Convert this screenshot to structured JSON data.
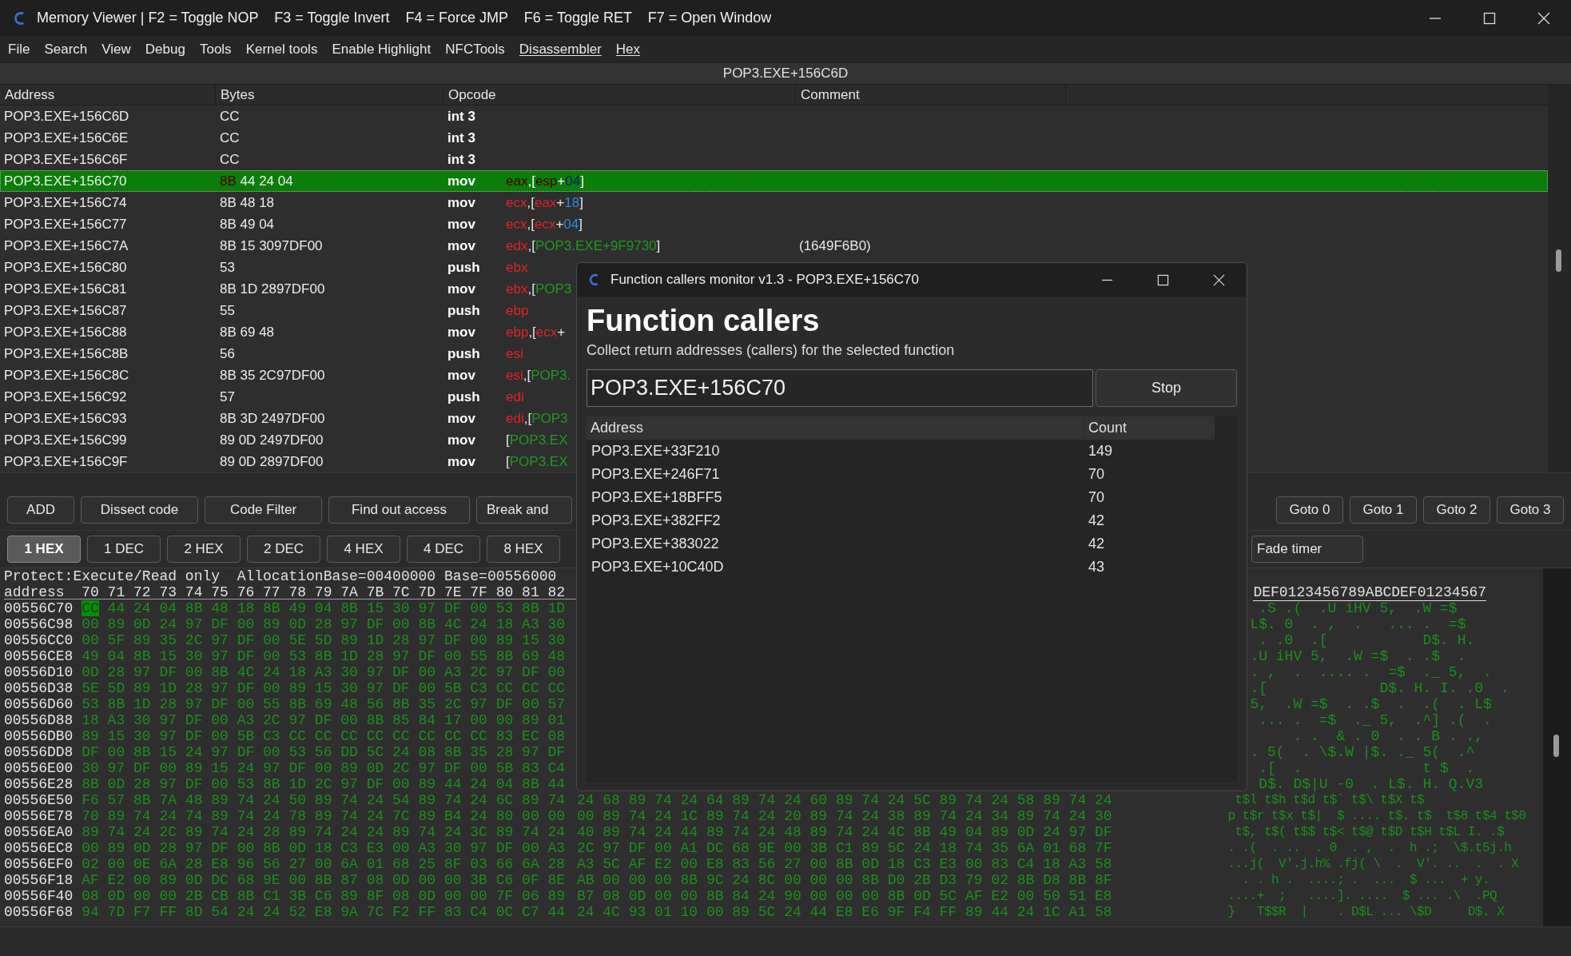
{
  "window": {
    "title": "Memory Viewer | F2 = Toggle NOP    F3 = Toggle Invert    F4 = Force JMP    F6 = Toggle RET    F7 = Open Window"
  },
  "menu": [
    {
      "label": "File",
      "underlined": false
    },
    {
      "label": "Search",
      "underlined": false
    },
    {
      "label": "View",
      "underlined": false
    },
    {
      "label": "Debug",
      "underlined": false
    },
    {
      "label": "Tools",
      "underlined": false
    },
    {
      "label": "Kernel tools",
      "underlined": false
    },
    {
      "label": "Enable Highlight",
      "underlined": false
    },
    {
      "label": "NFCTools",
      "underlined": false
    },
    {
      "label": "Disassembler",
      "underlined": true
    },
    {
      "label": "Hex",
      "underlined": true
    }
  ],
  "address_bar": "POP3.EXE+156C6D",
  "disassembly": {
    "columns": [
      "Address",
      "Bytes",
      "Opcode",
      "Comment"
    ],
    "rows": [
      {
        "address": "POP3.EXE+156C6D",
        "bytes": "CC",
        "opcode": "int 3",
        "operands": [],
        "selected": false
      },
      {
        "address": "POP3.EXE+156C6E",
        "bytes": "CC",
        "opcode": "int 3",
        "operands": [],
        "selected": false
      },
      {
        "address": "POP3.EXE+156C6F",
        "bytes": "CC",
        "opcode": "int 3",
        "operands": [],
        "selected": false
      },
      {
        "address": "POP3.EXE+156C70",
        "bytes": "8B 44 24 04",
        "opcode": "mov",
        "operands": [
          {
            "t": "eax",
            "kind": "reg"
          },
          {
            "t": ",[",
            "kind": "punct"
          },
          {
            "t": "esp",
            "kind": "reg"
          },
          {
            "t": "+",
            "kind": "punct"
          },
          {
            "t": "04",
            "kind": "num"
          },
          {
            "t": "]",
            "kind": "punct"
          }
        ],
        "selected": true
      },
      {
        "address": "POP3.EXE+156C74",
        "bytes": "8B 48 18",
        "opcode": "mov",
        "operands": [
          {
            "t": "ecx",
            "kind": "reg"
          },
          {
            "t": ",[",
            "kind": "punct"
          },
          {
            "t": "eax",
            "kind": "reg"
          },
          {
            "t": "+",
            "kind": "punct"
          },
          {
            "t": "18",
            "kind": "num"
          },
          {
            "t": "]",
            "kind": "punct"
          }
        ],
        "selected": false
      },
      {
        "address": "POP3.EXE+156C77",
        "bytes": "8B 49 04",
        "opcode": "mov",
        "operands": [
          {
            "t": "ecx",
            "kind": "reg"
          },
          {
            "t": ",[",
            "kind": "punct"
          },
          {
            "t": "ecx",
            "kind": "reg"
          },
          {
            "t": "+",
            "kind": "punct"
          },
          {
            "t": "04",
            "kind": "num"
          },
          {
            "t": "]",
            "kind": "punct"
          }
        ],
        "selected": false
      },
      {
        "address": "POP3.EXE+156C7A",
        "bytes": "8B 15 3097DF00",
        "opcode": "mov",
        "operands": [
          {
            "t": "edx",
            "kind": "reg"
          },
          {
            "t": ",[",
            "kind": "punct"
          },
          {
            "t": "POP3.EXE+9F9730",
            "kind": "sym"
          },
          {
            "t": "]",
            "kind": "punct"
          }
        ],
        "comment": "(1649F6B0)",
        "selected": false
      },
      {
        "address": "POP3.EXE+156C80",
        "bytes": "53",
        "opcode": "push",
        "operands": [
          {
            "t": "ebx",
            "kind": "reg"
          }
        ],
        "selected": false
      },
      {
        "address": "POP3.EXE+156C81",
        "bytes": "8B 1D 2897DF00",
        "opcode": "mov",
        "operands": [
          {
            "t": "ebx",
            "kind": "reg"
          },
          {
            "t": ",[",
            "kind": "punct"
          },
          {
            "t": "POP3",
            "kind": "sym"
          }
        ],
        "selected": false
      },
      {
        "address": "POP3.EXE+156C87",
        "bytes": "55",
        "opcode": "push",
        "operands": [
          {
            "t": "ebp",
            "kind": "reg"
          }
        ],
        "selected": false
      },
      {
        "address": "POP3.EXE+156C88",
        "bytes": "8B 69 48",
        "opcode": "mov",
        "operands": [
          {
            "t": "ebp",
            "kind": "reg"
          },
          {
            "t": ",[",
            "kind": "punct"
          },
          {
            "t": "ecx",
            "kind": "reg"
          },
          {
            "t": "+",
            "kind": "punct"
          }
        ],
        "selected": false
      },
      {
        "address": "POP3.EXE+156C8B",
        "bytes": "56",
        "opcode": "push",
        "operands": [
          {
            "t": "esi",
            "kind": "reg"
          }
        ],
        "selected": false
      },
      {
        "address": "POP3.EXE+156C8C",
        "bytes": "8B 35 2C97DF00",
        "opcode": "mov",
        "operands": [
          {
            "t": "esi",
            "kind": "reg"
          },
          {
            "t": ",[",
            "kind": "punct"
          },
          {
            "t": "POP3.",
            "kind": "sym"
          }
        ],
        "selected": false
      },
      {
        "address": "POP3.EXE+156C92",
        "bytes": "57",
        "opcode": "push",
        "operands": [
          {
            "t": "edi",
            "kind": "reg"
          }
        ],
        "selected": false
      },
      {
        "address": "POP3.EXE+156C93",
        "bytes": "8B 3D 2497DF00",
        "opcode": "mov",
        "operands": [
          {
            "t": "edi",
            "kind": "reg"
          },
          {
            "t": ",[",
            "kind": "punct"
          },
          {
            "t": "POP3",
            "kind": "sym"
          }
        ],
        "selected": false
      },
      {
        "address": "POP3.EXE+156C99",
        "bytes": "89 0D 2497DF00",
        "opcode": "mov",
        "operands": [
          {
            "t": "[",
            "kind": "punct"
          },
          {
            "t": "POP3.EX",
            "kind": "sym"
          }
        ],
        "selected": false
      },
      {
        "address": "POP3.EXE+156C9F",
        "bytes": "89 0D 2897DF00",
        "opcode": "mov",
        "operands": [
          {
            "t": "[",
            "kind": "punct"
          },
          {
            "t": "POP3.EX",
            "kind": "sym"
          }
        ],
        "selected": false
      }
    ]
  },
  "toolbar_buttons": [
    {
      "label": "ADD"
    },
    {
      "label": "Dissect code"
    },
    {
      "label": "Code Filter"
    },
    {
      "label": "Find out access"
    },
    {
      "label": "Break and"
    }
  ],
  "goto_buttons": [
    {
      "label": "Goto 0"
    },
    {
      "label": "Goto 1"
    },
    {
      "label": "Goto 2"
    },
    {
      "label": "Goto 3"
    }
  ],
  "display_tabs": [
    {
      "label": "1 HEX",
      "selected": true
    },
    {
      "label": "1 DEC",
      "selected": false
    },
    {
      "label": "2 HEX",
      "selected": false
    },
    {
      "label": "2 DEC",
      "selected": false
    },
    {
      "label": "4 HEX",
      "selected": false
    },
    {
      "label": "4 DEC",
      "selected": false
    },
    {
      "label": "8 HEX",
      "selected": false
    }
  ],
  "fade_timer_button": "Fade timer",
  "hex": {
    "info": "Protect:Execute/Read only  AllocationBase=00400000 Base=00556000",
    "header_address": "address",
    "header_bytes": "70 71 72 73 74 75 76 77 78 79 7A 7B 7C 7D 7E 7F 80 81 82",
    "header_ascii": "DEF0123456789ABCDEF01234567",
    "rows": [
      {
        "address": "00556C70",
        "bytes_left": "CC 44 24 04 8B 48 18 8B 49 04 8B 15 30 97 DF 00 53 8B 1D",
        "ascii": " .S .(  .U iHV 5,  .W =$",
        "cursor": true
      },
      {
        "address": "00556C98",
        "bytes_left": "00 89 0D 24 97 DF 00 89 0D 28 97 DF 00 8B 4C 24 18 A3 30",
        "ascii": "L$. 0  . ,  .   ... .  =$",
        "cursor": false
      },
      {
        "address": "00556CC0",
        "bytes_left": "00 5F 89 35 2C 97 DF 00 5E 5D 89 1D 28 97 DF 00 89 15 30",
        "ascii": " . .0  .[           D$. H.",
        "cursor": false
      },
      {
        "address": "00556CE8",
        "bytes_left": "49 04 8B 15 30 97 DF 00 53 8B 1D 28 97 DF 00 55 8B 69 48",
        "ascii": ".U iHV 5,  .W =$  . .$  .",
        "cursor": false
      },
      {
        "address": "00556D10",
        "bytes_left": "0D 28 97 DF 00 8B 4C 24 18 A3 30 97 DF 00 A3 2C 97 DF 00",
        "ascii": ". ,  .  .... .  =$  ._ 5,  .",
        "cursor": false
      },
      {
        "address": "00556D38",
        "bytes_left": "5E 5D 89 1D 28 97 DF 00 89 15 30 97 DF 00 5B C3 CC CC CC",
        "ascii": ".[             D$. H. I. .0  .",
        "cursor": false
      },
      {
        "address": "00556D60",
        "bytes_left": "53 8B 1D 28 97 DF 00 55 8B 69 48 56 8B 35 2C 97 DF 00 57",
        "ascii": "5,  .W =$  . .$  .  .(  . L$",
        "cursor": false
      },
      {
        "address": "00556D88",
        "bytes_left": "18 A3 30 97 DF 00 A3 2C 97 DF 00 8B 85 84 17 00 00 89 01",
        "ascii": " ... .  =$  ._ 5,  .^] .(  .",
        "cursor": false
      },
      {
        "address": "00556DB0",
        "bytes_left": "89 15 30 97 DF 00 5B C3 CC CC CC CC CC CC CC CC 83 EC 08",
        "ascii": "     . .  & . 0  . . B . .,",
        "cursor": false
      },
      {
        "address": "00556DD8",
        "bytes_left": "DF 00 8B 15 24 97 DF 00 53 56 DD 5C 24 08 8B 35 28 97 DF",
        "ascii": ". 5(  . \\$.W |$. ._ 5(  .^",
        "cursor": false
      },
      {
        "address": "00556E00",
        "bytes_left": "30 97 DF 00 89 15 24 97 DF 00 89 0D 2C 97 DF 00 5B 83 C4",
        "ascii": " .[  .              t $  .",
        "cursor": false
      },
      {
        "address": "00556E28",
        "bytes_left": "8B 0D 28 97 DF 00 53 8B 1D 2C 97 DF 00 89 44 24 04 8B 44",
        "ascii": " D$. D$|U -0  . L$. H. Q.V3",
        "cursor": false
      },
      {
        "address": "00556E50",
        "bytes_left": "F6 57 8B 7A 48 89 74 24 50 89 74 24 54 89 74 24 6C 89 74",
        "bytes_middle": "24 68 89 74 24 64 89 74 24 60 89 74 24 5C 89 74 24 58 89 74 24",
        "ascii": " t$l t$h t$d t$` t$\\ t$X t$",
        "cursor": false
      },
      {
        "address": "00556E78",
        "bytes_left": "70 89 74 24 74 89 74 24 78 89 74 24 7C 89 B4 24 80 00 00",
        "bytes_middle": "00 89 74 24 1C 89 74 24 20 89 74 24 38 89 74 24 34 89 74 24 30",
        "ascii": "p t$r t$x t$|  $ .... t$. t$  t$8 t$4 t$0",
        "cursor": false
      },
      {
        "address": "00556EA0",
        "bytes_left": "89 74 24 2C 89 74 24 28 89 74 24 24 89 74 24 3C 89 74 24",
        "bytes_middle": "40 89 74 24 44 89 74 24 48 89 74 24 4C 8B 49 04 89 0D 24 97 DF",
        "ascii": " t$, t$( t$$ t$< t$@ t$D t$H t$L I. .$",
        "cursor": false
      },
      {
        "address": "00556EC8",
        "bytes_left": "00 89 0D 28 97 DF 00 8B 0D 18 C3 E3 00 A3 30 97 DF 00 A3",
        "bytes_middle": "2C 97 DF 00 A1 DC 68 9E 00 3B C1 89 5C 24 18 74 35 6A 01 68 7F",
        "ascii": ". .(  . ..  . 0  . ,  .  h .;  \\$.t5j.h",
        "cursor": false
      },
      {
        "address": "00556EF0",
        "bytes_left": "02 00 0E 6A 28 E8 96 56 27 00 6A 01 68 25 8F 03 66 6A 28",
        "bytes_middle": "A3 5C AF E2 00 E8 83 56 27 00 8B 0D 18 C3 E3 00 83 C4 18 A3 58",
        "ascii": "...j(  V'.j.h% .fj( \\  .  V'. ..  .  . X",
        "cursor": false
      },
      {
        "address": "00556F18",
        "bytes_left": "AF E2 00 89 0D DC 68 9E 00 8B 87 08 0D 00 00 3B C6 0F 8E",
        "bytes_middle": "AB 00 00 00 8B 9C 24 8C 00 00 00 8B D0 2B D3 79 02 8B D8 8B 8F",
        "ascii": "  . . h .  ....; .  ...  $ ...  + y.",
        "cursor": false
      },
      {
        "address": "00556F40",
        "bytes_left": "08 0D 00 00 2B CB 8B C1 3B C6 89 8F 08 0D 00 00 7F 06 89",
        "bytes_middle": "B7 08 0D 00 00 8B 84 24 90 00 00 00 8B 0D 5C AF E2 00 50 51 E8",
        "ascii": "....+  ;   ....]. ....  $ ... .\\  .PQ",
        "cursor": false
      },
      {
        "address": "00556F68",
        "bytes_left": "94 7D F7 FF 8D 54 24 24 52 E8 9A 7C F2 FF 83 C4 0C C7 44",
        "bytes_middle": "24 4C 93 01 10 00 89 5C 24 44 E8 E6 9F F4 FF 89 44 24 1C A1 58",
        "ascii": "}   T$$R  |    . D$L ... \\$D     D$. X",
        "cursor": false
      }
    ]
  },
  "callers_dialog": {
    "title": "Function callers monitor v1.3 - POP3.EXE+156C70",
    "heading": "Function callers",
    "description": "Collect return addresses (callers) for the selected function",
    "address_value": "POP3.EXE+156C70",
    "button": "Stop",
    "columns": [
      "Address",
      "Count"
    ],
    "rows": [
      {
        "address": "POP3.EXE+33F210",
        "count": "149"
      },
      {
        "address": "POP3.EXE+246F71",
        "count": "70"
      },
      {
        "address": "POP3.EXE+18BFF5",
        "count": "70"
      },
      {
        "address": "POP3.EXE+382FF2",
        "count": "42"
      },
      {
        "address": "POP3.EXE+383022",
        "count": "42"
      },
      {
        "address": "POP3.EXE+10C40D",
        "count": "43"
      }
    ]
  }
}
